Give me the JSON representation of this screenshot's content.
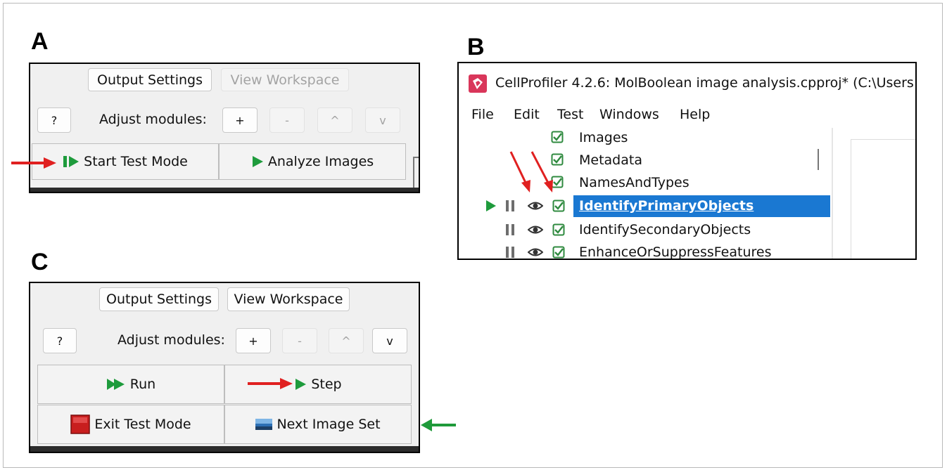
{
  "panels": {
    "a": {
      "label": "A",
      "output_settings": "Output Settings",
      "view_workspace": "View Workspace",
      "help": "?",
      "adjust_label": "Adjust modules:",
      "add": "+",
      "remove": "-",
      "up": "^",
      "down": "v",
      "start_test_mode": "Start Test Mode",
      "analyze_images": "Analyze Images"
    },
    "b": {
      "label": "B",
      "window_title": "CellProfiler 4.2.6: MolBoolean image analysis.cpproj* (C:\\Users",
      "menu": [
        "File",
        "Edit",
        "Test",
        "Windows",
        "Help"
      ],
      "modules": [
        "Images",
        "Metadata",
        "NamesAndTypes",
        "IdentifyPrimaryObjects",
        "IdentifySecondaryObjects",
        "EnhanceOrSuppressFeatures"
      ]
    },
    "c": {
      "label": "C",
      "output_settings": "Output Settings",
      "view_workspace": "View Workspace",
      "help": "?",
      "adjust_label": "Adjust modules:",
      "add": "+",
      "remove": "-",
      "up": "^",
      "down": "v",
      "run": "Run",
      "step": "Step",
      "exit_test_mode": "Exit Test Mode",
      "next_image_set": "Next Image Set"
    }
  },
  "colors": {
    "red_arrow": "#e02020",
    "green_arrow": "#1f9a3a",
    "play_green": "#1e9b3c",
    "selection_blue": "#1a78d2",
    "app_icon": "#d9365a"
  }
}
